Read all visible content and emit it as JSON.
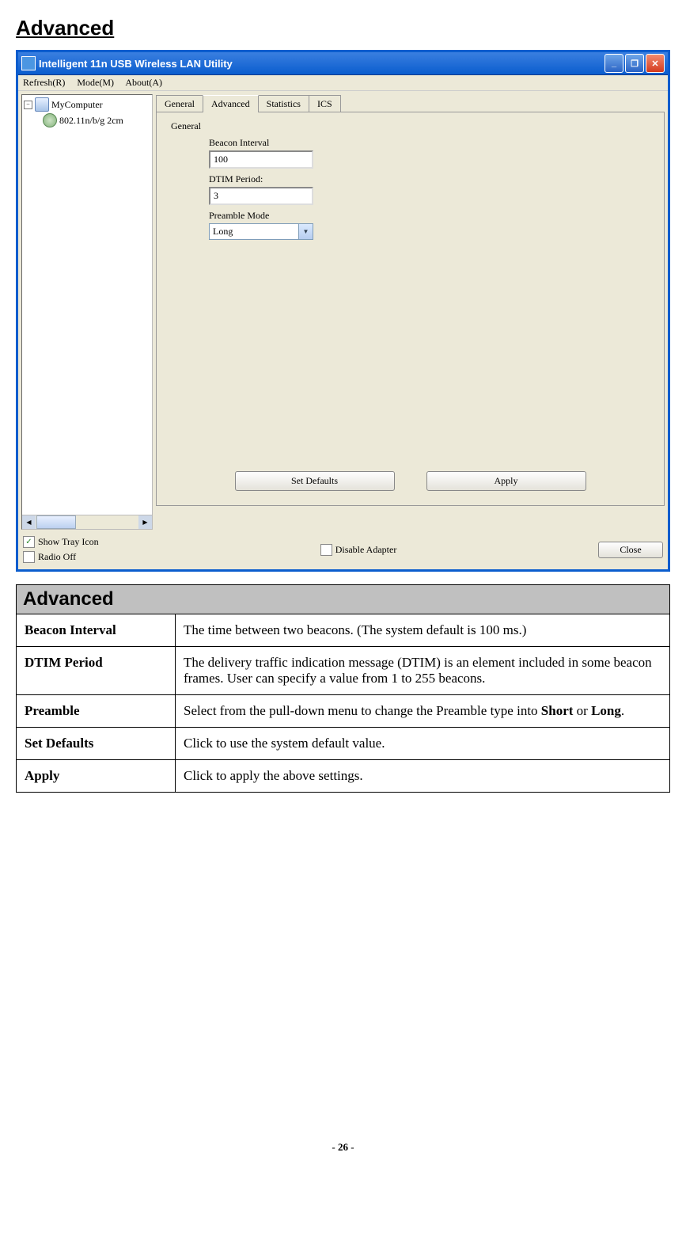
{
  "page_title": "Advanced",
  "window": {
    "title": "Intelligent 11n USB Wireless LAN Utility",
    "menu": {
      "refresh": "Refresh(R)",
      "mode": "Mode(M)",
      "about": "About(A)"
    },
    "tree": {
      "root": "MyComputer",
      "child": "802.11n/b/g 2cm"
    },
    "tabs": {
      "general": "General",
      "advanced": "Advanced",
      "statistics": "Statistics",
      "ics": "ICS"
    },
    "form": {
      "group_title": "General",
      "beacon_label": "Beacon Interval",
      "beacon_value": "100",
      "dtim_label": "DTIM Period:",
      "dtim_value": "3",
      "preamble_label": "Preamble Mode",
      "preamble_value": "Long"
    },
    "buttons": {
      "set_defaults": "Set Defaults",
      "apply": "Apply"
    },
    "options": {
      "show_tray": "Show Tray Icon",
      "show_tray_checked": true,
      "radio_off": "Radio Off",
      "radio_off_checked": false,
      "disable_adapter": "Disable Adapter",
      "disable_adapter_checked": false
    },
    "close": "Close"
  },
  "table": {
    "header": "Advanced",
    "rows": [
      {
        "key": "Beacon Interval",
        "val": "The time between two beacons. (The system default is 100 ms.)"
      },
      {
        "key": "DTIM Period",
        "val": "The delivery traffic indication message (DTIM) is an element included in some beacon frames. User can specify a value from 1 to 255 beacons."
      },
      {
        "key": "Preamble",
        "val_pre": "Select from the pull-down menu to change the Preamble type into ",
        "val_b1": "Short",
        "val_mid": " or ",
        "val_b2": "Long",
        "val_post": "."
      },
      {
        "key": "Set Defaults",
        "val": "Click to use the system default value."
      },
      {
        "key": "Apply",
        "val": "Click to apply the above settings."
      }
    ]
  },
  "page_number": "26"
}
